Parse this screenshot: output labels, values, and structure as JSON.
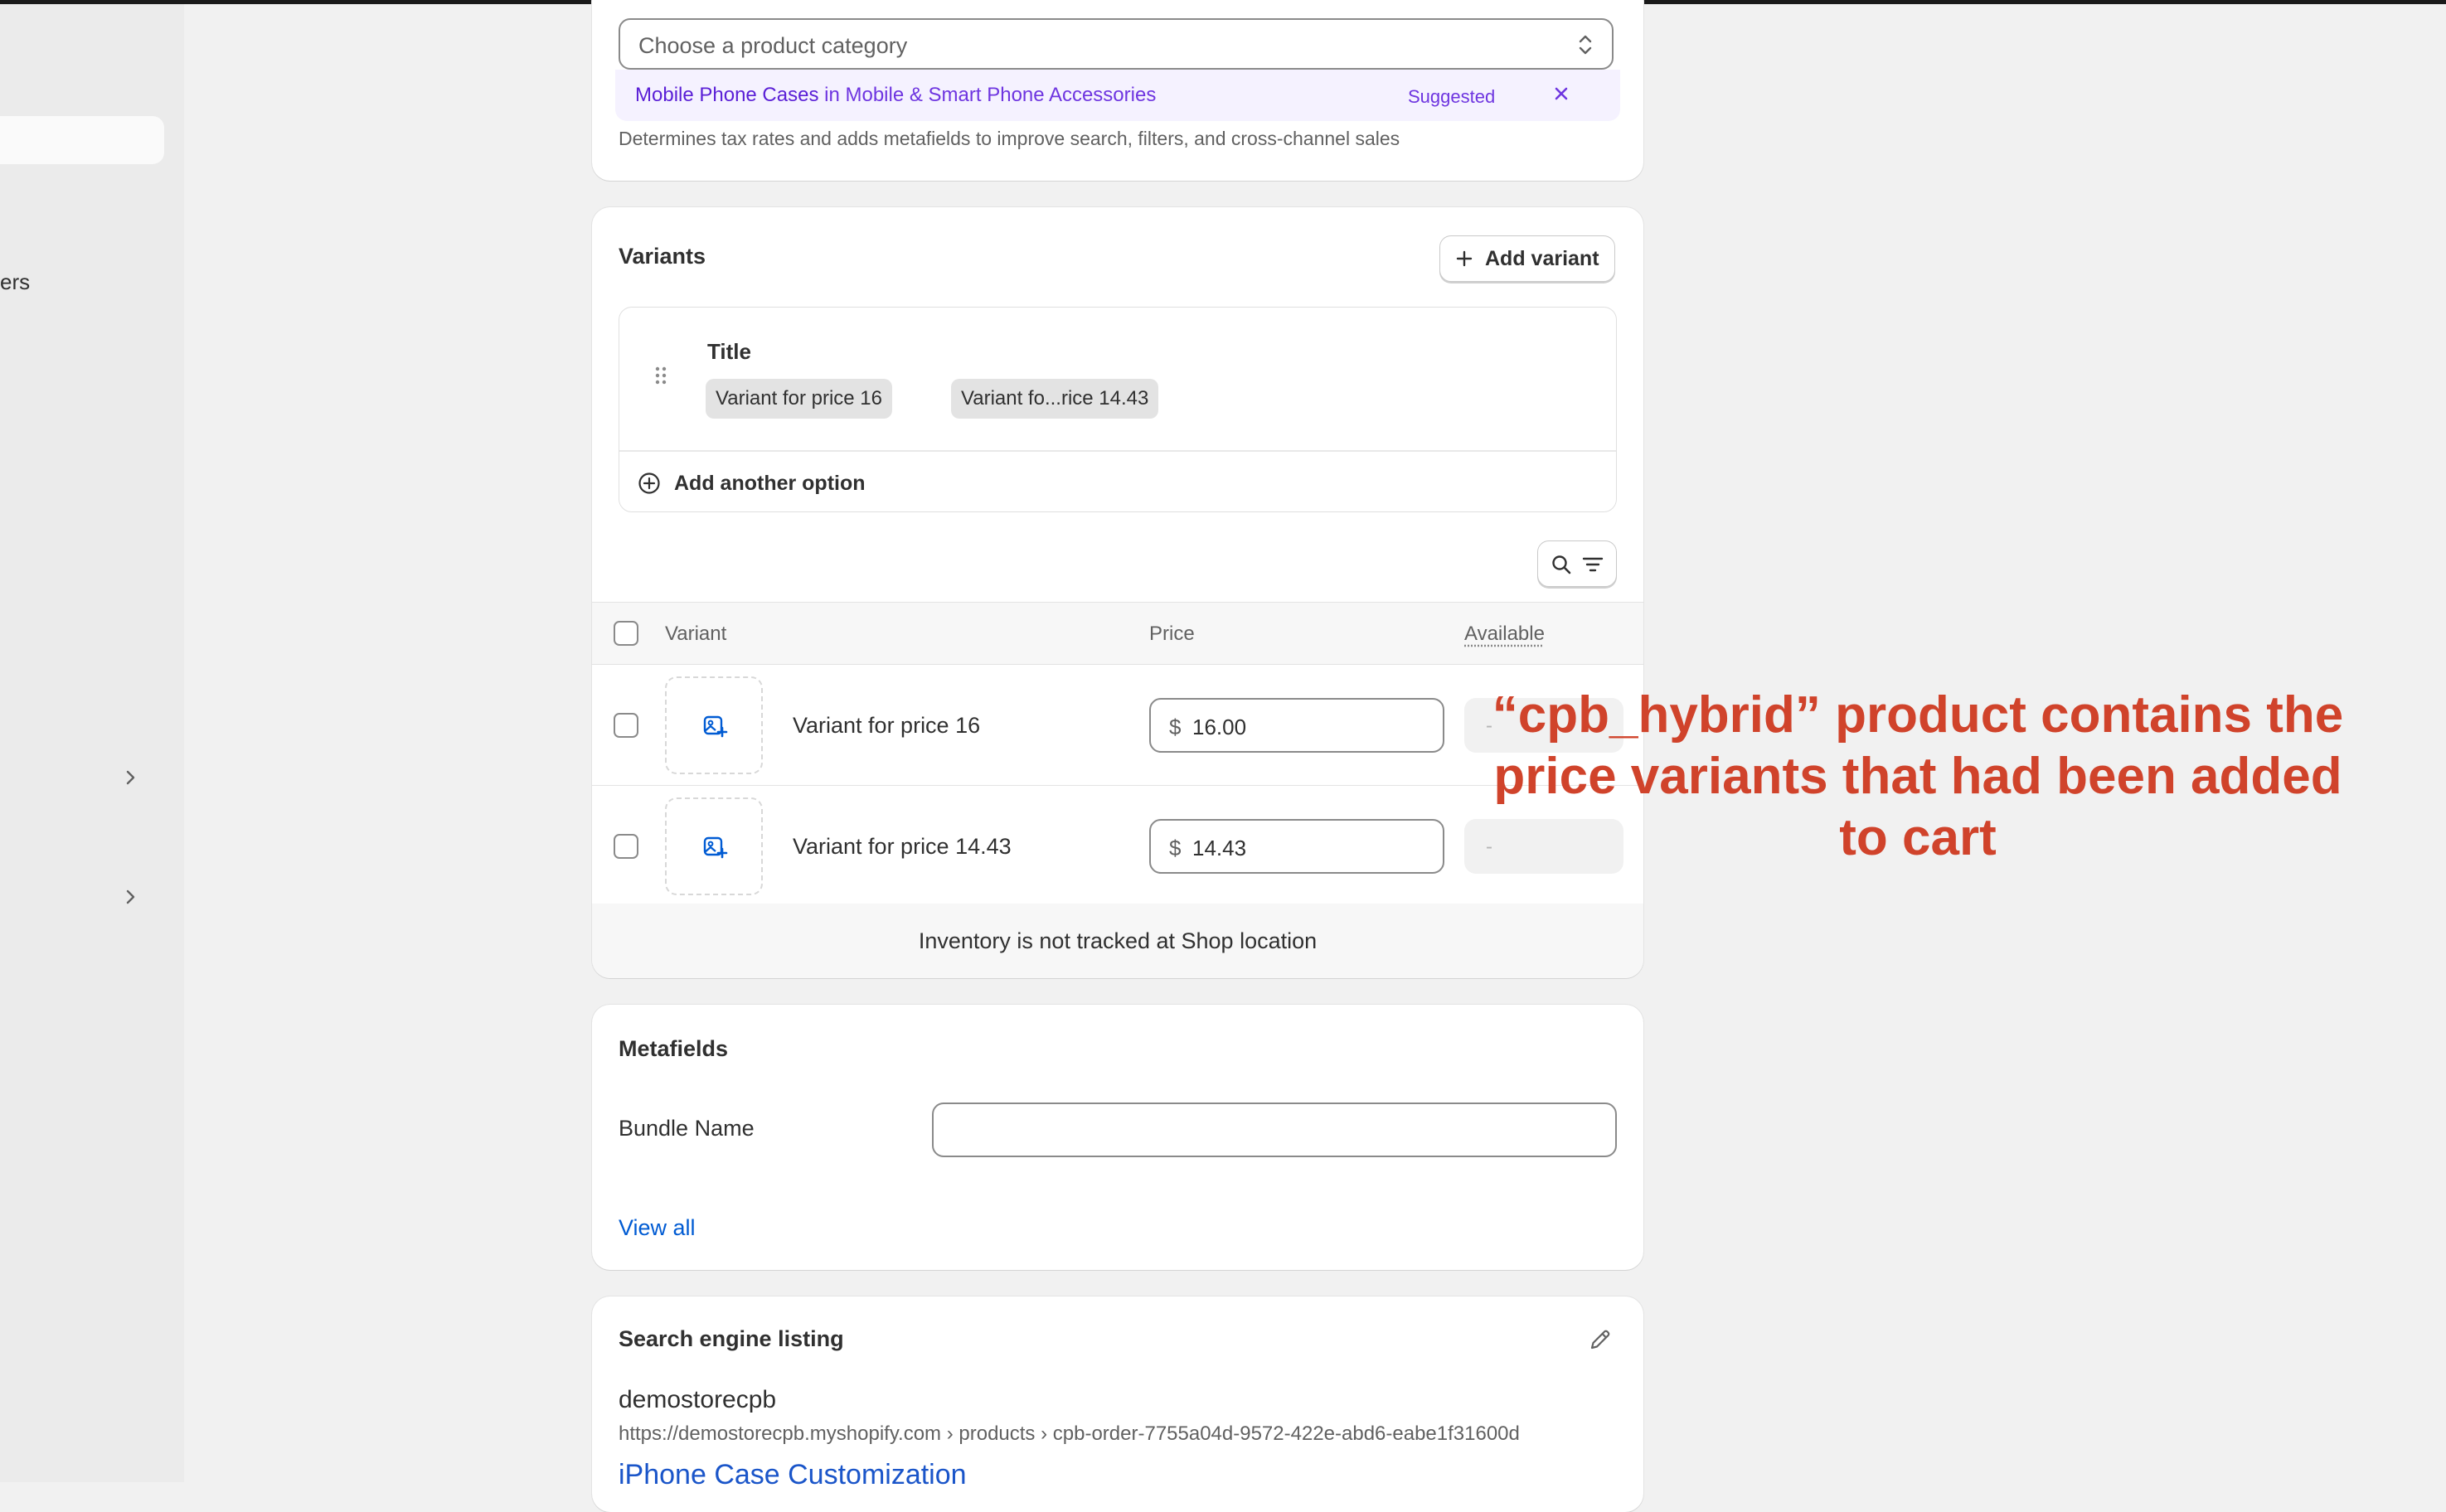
{
  "sidebar": {
    "partial_label": "ers"
  },
  "category": {
    "placeholder": "Choose a product category",
    "suggestion_name": "Mobile Phone Cases",
    "suggestion_in": "in Mobile & Smart Phone Accessories",
    "suggested_badge": "Suggested",
    "help_text": "Determines tax rates and adds metafields to improve search, filters, and cross-channel sales"
  },
  "variants": {
    "title": "Variants",
    "add_variant_label": "Add variant",
    "option_title": "Title",
    "option_values": [
      "Variant for price 16",
      "Variant fo...rice 14.43"
    ],
    "add_option_label": "Add another option",
    "columns": {
      "variant": "Variant",
      "price": "Price",
      "available": "Available"
    },
    "rows": [
      {
        "name": "Variant for price 16",
        "currency": "$",
        "price": "16.00",
        "available": "-"
      },
      {
        "name": "Variant for price 14.43",
        "currency": "$",
        "price": "14.43",
        "available": "-"
      }
    ],
    "inventory_note": "Inventory is not tracked at Shop location"
  },
  "metafields": {
    "title": "Metafields",
    "field_label": "Bundle Name",
    "field_value": "",
    "view_all": "View all"
  },
  "seo": {
    "title": "Search engine listing",
    "store_name": "demostorecpb",
    "url": "https://demostorecpb.myshopify.com › products › cpb-order-7755a04d-9572-422e-abd6-eabe1f31600d",
    "page_title": "iPhone Case Customization"
  },
  "annotation": {
    "line1": "“cpb_hybrid” product contains the",
    "line2": "price variants that had been added",
    "line3": "to cart"
  },
  "colors": {
    "accent_purple": "#6e35e0",
    "link_blue": "#005bd3",
    "annotation_red": "#d0432b"
  }
}
